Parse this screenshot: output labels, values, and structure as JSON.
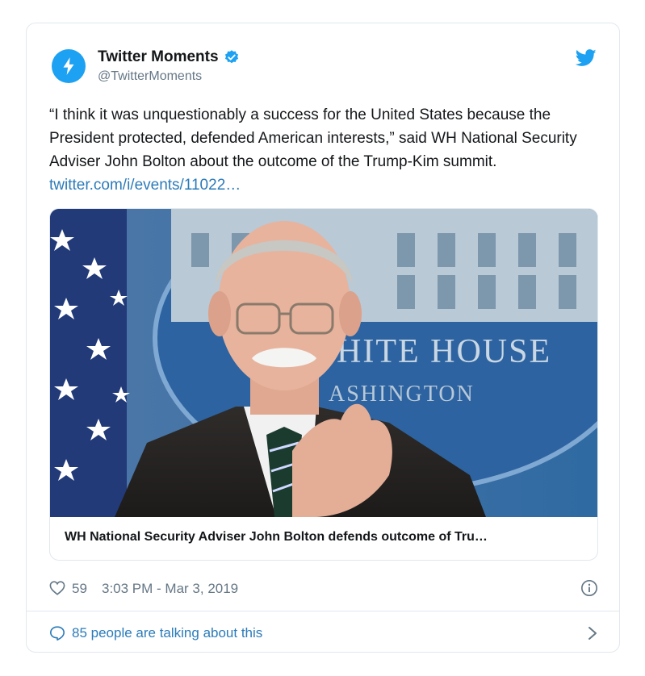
{
  "author": {
    "name": "Twitter Moments",
    "handle": "@TwitterMoments",
    "verified": true
  },
  "tweet": {
    "text": "“I think it was unquestionably a success for the United States because the President protected, defended American interests,” said WH National Security Adviser John Bolton about the outcome of the Trump-Kim summit. ",
    "link_text": "twitter.com/i/events/11022…"
  },
  "media": {
    "title": "WH National Security Adviser John Bolton defends outcome of Tru…",
    "backdrop_text_line1": "HITE HOUSE",
    "backdrop_text_line2": "ASHINGTON"
  },
  "meta": {
    "like_count": "59",
    "timestamp": "3:03 PM - Mar 3, 2019"
  },
  "conversation": {
    "label": "85 people are talking about this"
  },
  "colors": {
    "brand_blue": "#1da1f2",
    "link_blue": "#2b7bb9",
    "muted_gray": "#657786",
    "border": "#e1e8ed"
  },
  "icons": [
    "lightning-icon",
    "verified-badge-icon",
    "twitter-bird-icon",
    "heart-icon",
    "info-icon",
    "speech-bubble-icon",
    "chevron-right-icon"
  ]
}
